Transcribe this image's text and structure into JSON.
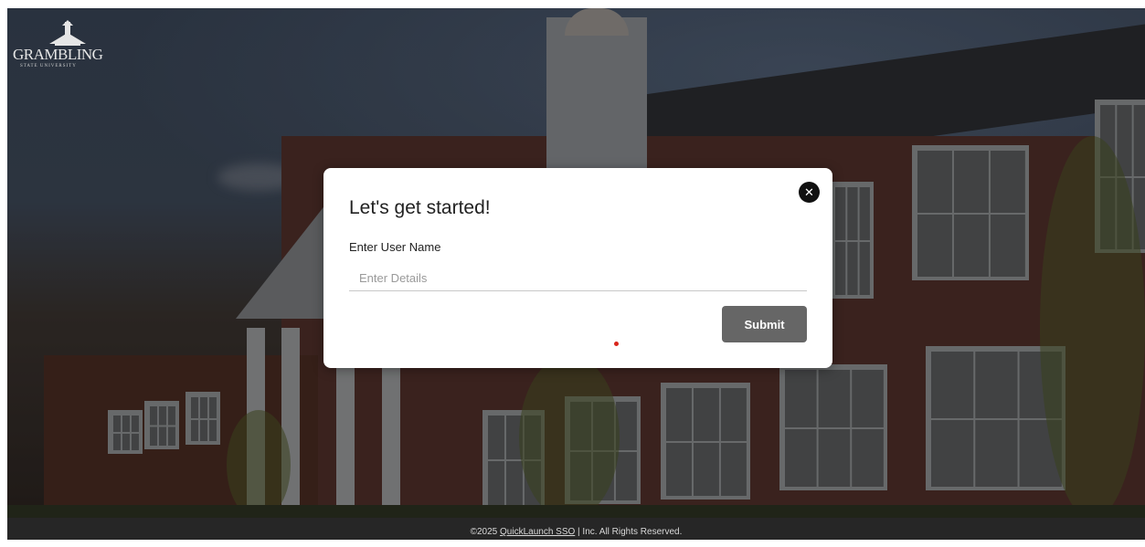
{
  "logo": {
    "wordmark": "GRAMBLING",
    "subtitle": "STATE UNIVERSITY"
  },
  "modal": {
    "title": "Let's get started!",
    "close_icon": "close-icon",
    "field_label": "Enter User Name",
    "field_value": "",
    "field_placeholder": "Enter Details",
    "submit_label": "Submit"
  },
  "footer": {
    "prefix": "©2025 ",
    "link_text": "QuickLaunch SSO",
    "suffix": " | Inc. All Rights Reserved."
  },
  "colors": {
    "submit_button": "#666666",
    "close_button": "#111111",
    "loader_dot": "#d9261c",
    "footer_bg": "#262626"
  }
}
